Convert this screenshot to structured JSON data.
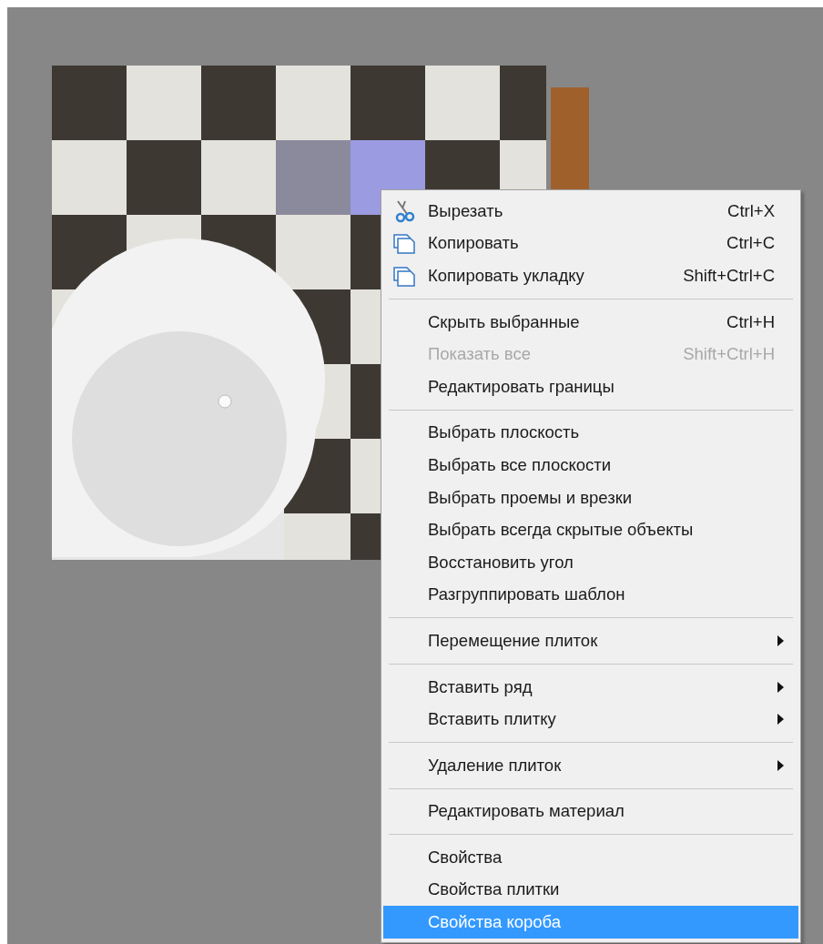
{
  "context_menu": {
    "groups": [
      {
        "items": [
          {
            "label": "Вырезать",
            "shortcut": "Ctrl+X",
            "kind": "scissors",
            "disabled": false,
            "selected": false,
            "submenu": false
          },
          {
            "label": "Копировать",
            "shortcut": "Ctrl+C",
            "kind": "copy",
            "disabled": false,
            "selected": false,
            "submenu": false
          },
          {
            "label": "Копировать укладку",
            "shortcut": "Shift+Ctrl+C",
            "kind": "copy",
            "disabled": false,
            "selected": false,
            "submenu": false
          }
        ]
      },
      {
        "items": [
          {
            "label": "Скрыть выбранные",
            "shortcut": "Ctrl+H",
            "disabled": false,
            "selected": false,
            "submenu": false
          },
          {
            "label": "Показать все",
            "shortcut": "Shift+Ctrl+H",
            "disabled": true,
            "selected": false,
            "submenu": false
          },
          {
            "label": "Редактировать границы",
            "disabled": false,
            "selected": false,
            "submenu": false
          }
        ]
      },
      {
        "items": [
          {
            "label": "Выбрать плоскость",
            "disabled": false,
            "selected": false,
            "submenu": false
          },
          {
            "label": "Выбрать все плоскости",
            "disabled": false,
            "selected": false,
            "submenu": false
          },
          {
            "label": "Выбрать проемы и врезки",
            "disabled": false,
            "selected": false,
            "submenu": false
          },
          {
            "label": "Выбрать всегда скрытые объекты",
            "disabled": false,
            "selected": false,
            "submenu": false
          },
          {
            "label": "Восстановить угол",
            "disabled": false,
            "selected": false,
            "submenu": false
          },
          {
            "label": "Разгруппировать шаблон",
            "disabled": false,
            "selected": false,
            "submenu": false
          }
        ]
      },
      {
        "items": [
          {
            "label": "Перемещение плиток",
            "disabled": false,
            "selected": false,
            "submenu": true
          }
        ]
      },
      {
        "items": [
          {
            "label": "Вставить ряд",
            "disabled": false,
            "selected": false,
            "submenu": true
          },
          {
            "label": "Вставить плитку",
            "disabled": false,
            "selected": false,
            "submenu": true
          }
        ]
      },
      {
        "items": [
          {
            "label": "Удаление плиток",
            "disabled": false,
            "selected": false,
            "submenu": true
          }
        ]
      },
      {
        "items": [
          {
            "label": "Редактировать материал",
            "disabled": false,
            "selected": false,
            "submenu": false
          }
        ]
      },
      {
        "items": [
          {
            "label": "Свойства",
            "disabled": false,
            "selected": false,
            "submenu": false
          },
          {
            "label": "Свойства плитки",
            "disabled": false,
            "selected": false,
            "submenu": false
          },
          {
            "label": "Свойства короба",
            "disabled": false,
            "selected": true,
            "submenu": false
          }
        ]
      }
    ]
  }
}
